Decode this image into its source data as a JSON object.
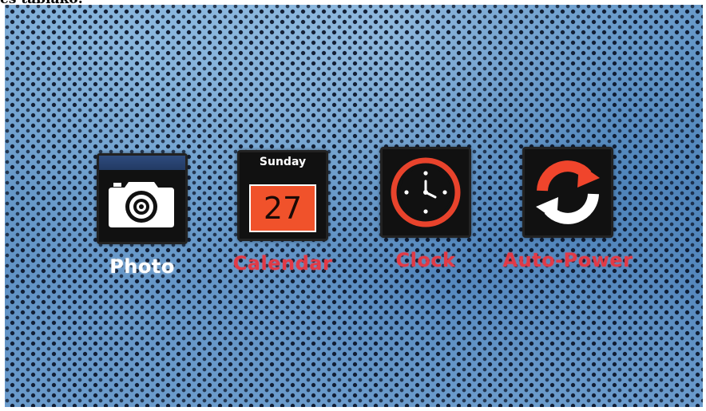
{
  "header": {
    "caption": "es tablakó:"
  },
  "menu": {
    "items": [
      {
        "id": "photo",
        "label": "Photo",
        "icon": "camera-icon",
        "selected": true
      },
      {
        "id": "calendar",
        "label": "Calendar",
        "icon": "calendar-icon",
        "day_name": "Sunday",
        "date": "27",
        "selected": false
      },
      {
        "id": "clock",
        "label": "Clock",
        "icon": "clock-icon",
        "selected": false
      },
      {
        "id": "auto-power",
        "label": "Auto-Power",
        "icon": "refresh-icon",
        "selected": false
      }
    ]
  },
  "colors": {
    "selected_label": "#ffffff",
    "unselected_label": "#e23a46",
    "calendar_accent": "#f0522b",
    "clock_accent": "#e8432c",
    "power_accent": "#f0452c",
    "background": "#5a8cc0"
  }
}
